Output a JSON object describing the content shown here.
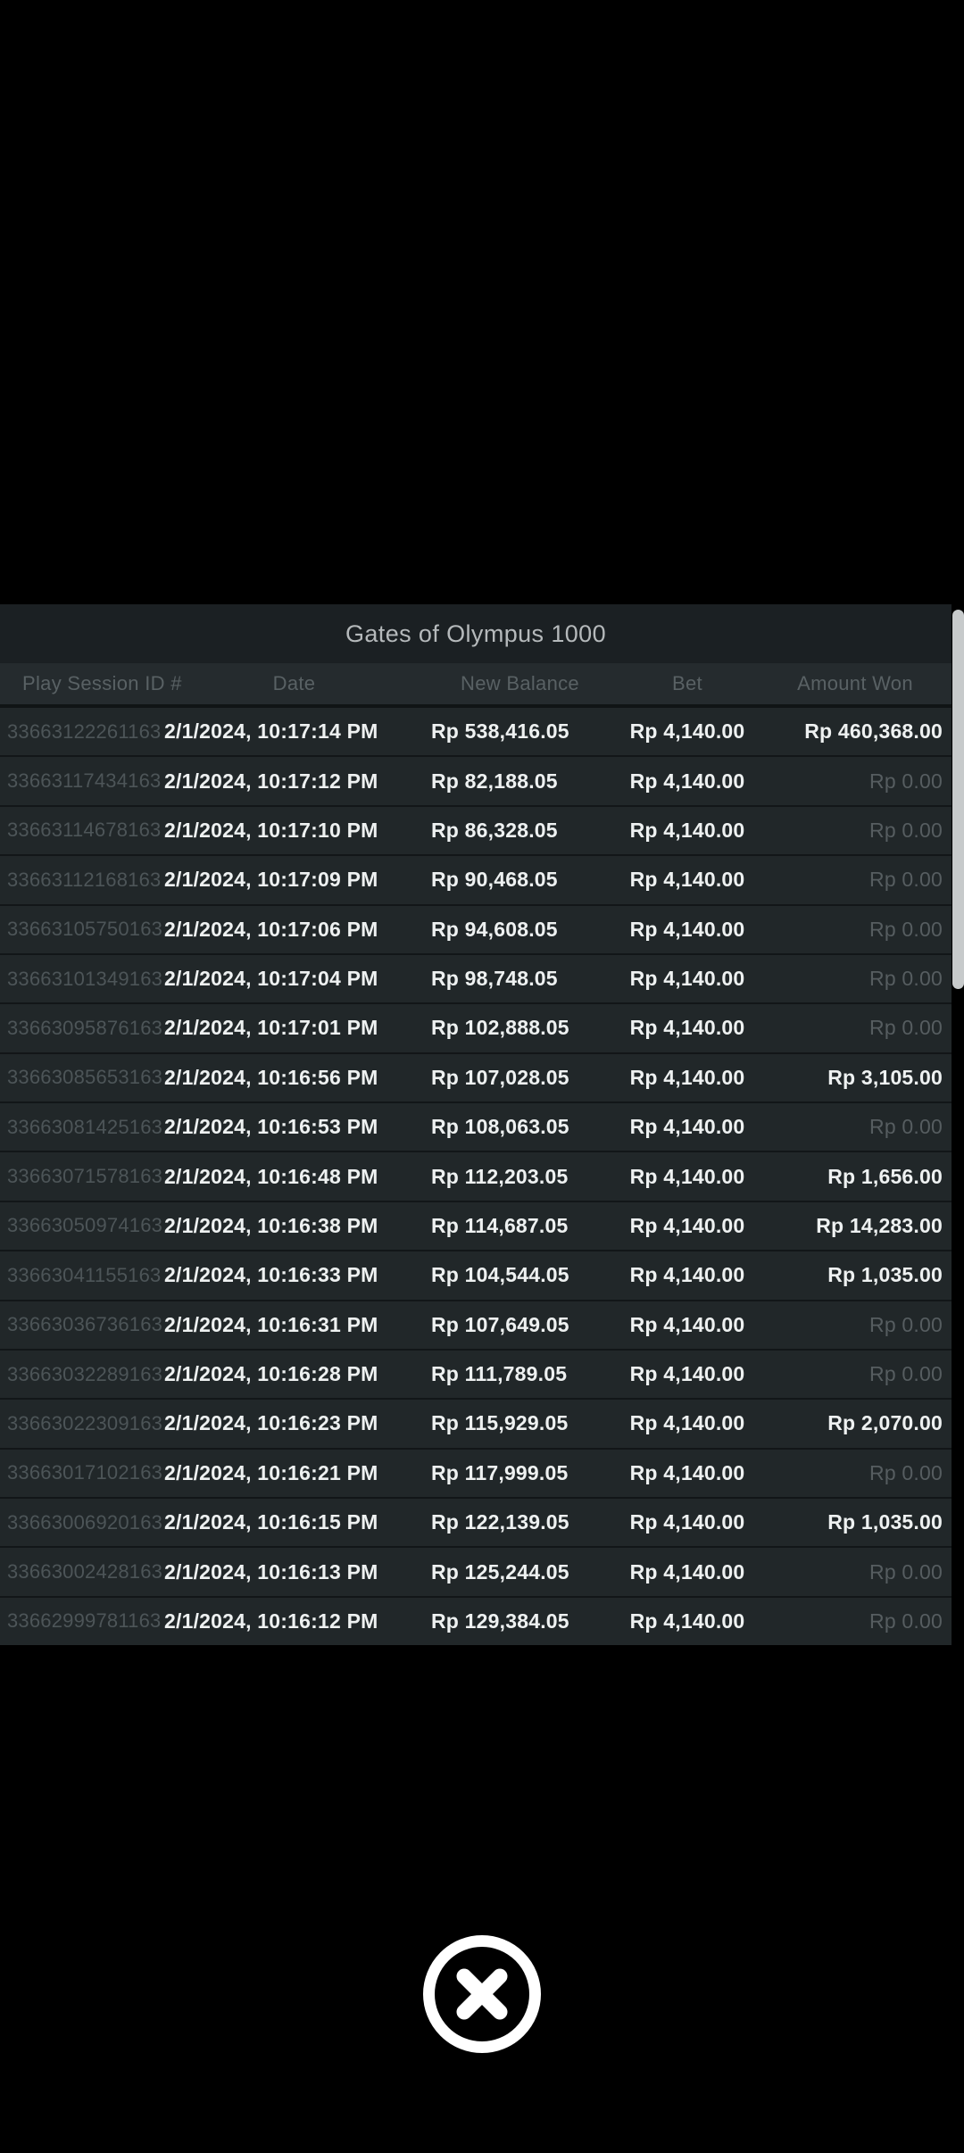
{
  "modal": {
    "title": "Gates of Olympus 1000",
    "columns": [
      "Play Session ID #",
      "Date",
      "New Balance",
      "Bet",
      "Amount Won"
    ],
    "rows": [
      {
        "id": "33663122261163",
        "date": "2/1/2024, 10:17:14 PM",
        "balance": "Rp 538,416.05",
        "bet": "Rp 4,140.00",
        "won": "Rp 460,368.00"
      },
      {
        "id": "33663117434163",
        "date": "2/1/2024, 10:17:12 PM",
        "balance": "Rp 82,188.05",
        "bet": "Rp 4,140.00",
        "won": "Rp 0.00"
      },
      {
        "id": "33663114678163",
        "date": "2/1/2024, 10:17:10 PM",
        "balance": "Rp 86,328.05",
        "bet": "Rp 4,140.00",
        "won": "Rp 0.00"
      },
      {
        "id": "33663112168163",
        "date": "2/1/2024, 10:17:09 PM",
        "balance": "Rp 90,468.05",
        "bet": "Rp 4,140.00",
        "won": "Rp 0.00"
      },
      {
        "id": "33663105750163",
        "date": "2/1/2024, 10:17:06 PM",
        "balance": "Rp 94,608.05",
        "bet": "Rp 4,140.00",
        "won": "Rp 0.00"
      },
      {
        "id": "33663101349163",
        "date": "2/1/2024, 10:17:04 PM",
        "balance": "Rp 98,748.05",
        "bet": "Rp 4,140.00",
        "won": "Rp 0.00"
      },
      {
        "id": "33663095876163",
        "date": "2/1/2024, 10:17:01 PM",
        "balance": "Rp 102,888.05",
        "bet": "Rp 4,140.00",
        "won": "Rp 0.00"
      },
      {
        "id": "33663085653163",
        "date": "2/1/2024, 10:16:56 PM",
        "balance": "Rp 107,028.05",
        "bet": "Rp 4,140.00",
        "won": "Rp 3,105.00"
      },
      {
        "id": "33663081425163",
        "date": "2/1/2024, 10:16:53 PM",
        "balance": "Rp 108,063.05",
        "bet": "Rp 4,140.00",
        "won": "Rp 0.00"
      },
      {
        "id": "33663071578163",
        "date": "2/1/2024, 10:16:48 PM",
        "balance": "Rp 112,203.05",
        "bet": "Rp 4,140.00",
        "won": "Rp 1,656.00"
      },
      {
        "id": "33663050974163",
        "date": "2/1/2024, 10:16:38 PM",
        "balance": "Rp 114,687.05",
        "bet": "Rp 4,140.00",
        "won": "Rp 14,283.00"
      },
      {
        "id": "33663041155163",
        "date": "2/1/2024, 10:16:33 PM",
        "balance": "Rp 104,544.05",
        "bet": "Rp 4,140.00",
        "won": "Rp 1,035.00"
      },
      {
        "id": "33663036736163",
        "date": "2/1/2024, 10:16:31 PM",
        "balance": "Rp 107,649.05",
        "bet": "Rp 4,140.00",
        "won": "Rp 0.00"
      },
      {
        "id": "33663032289163",
        "date": "2/1/2024, 10:16:28 PM",
        "balance": "Rp 111,789.05",
        "bet": "Rp 4,140.00",
        "won": "Rp 0.00"
      },
      {
        "id": "33663022309163",
        "date": "2/1/2024, 10:16:23 PM",
        "balance": "Rp 115,929.05",
        "bet": "Rp 4,140.00",
        "won": "Rp 2,070.00"
      },
      {
        "id": "33663017102163",
        "date": "2/1/2024, 10:16:21 PM",
        "balance": "Rp 117,999.05",
        "bet": "Rp 4,140.00",
        "won": "Rp 0.00"
      },
      {
        "id": "33663006920163",
        "date": "2/1/2024, 10:16:15 PM",
        "balance": "Rp 122,139.05",
        "bet": "Rp 4,140.00",
        "won": "Rp 1,035.00"
      },
      {
        "id": "33663002428163",
        "date": "2/1/2024, 10:16:13 PM",
        "balance": "Rp 125,244.05",
        "bet": "Rp 4,140.00",
        "won": "Rp 0.00"
      },
      {
        "id": "33662999781163",
        "date": "2/1/2024, 10:16:12 PM",
        "balance": "Rp 129,384.05",
        "bet": "Rp 4,140.00",
        "won": "Rp 0.00"
      }
    ],
    "zero_amount_text": "Rp 0.00"
  },
  "colors": {
    "background": "#000000",
    "panel_row_bg": "#212729",
    "panel_title_bg": "#1b2023",
    "panel_header_bg": "#252b2e",
    "row_separator": "#121618",
    "title_text": "#b5b9bb",
    "header_text": "#596164",
    "id_text": "#4d5558",
    "value_text": "#eef1f1",
    "zero_text": "#565d60",
    "scrollbar_thumb": "#c7cacb",
    "close_button": "#ffffff"
  }
}
